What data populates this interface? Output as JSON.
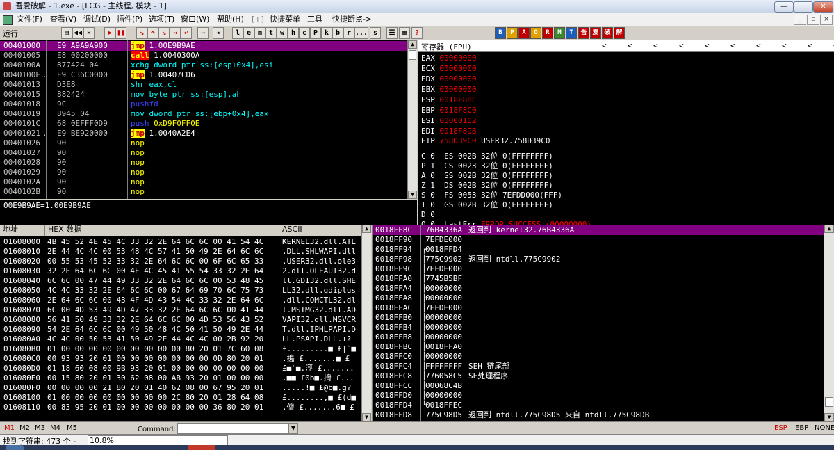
{
  "window": {
    "title": "吾爱破解 - 1.exe - [LCG - 主线程, 模块 - 1]",
    "btn_min": "—",
    "btn_max": "❐",
    "btn_close": "✕"
  },
  "menu": {
    "items": [
      "文件(F)",
      "查看(V)",
      "调试(D)",
      "插件(P)",
      "选项(T)",
      "窗口(W)",
      "帮助(H)",
      "[+]",
      "快捷菜单",
      "工具",
      "快捷断点->"
    ]
  },
  "toolbar": {
    "run_state": "运行",
    "letters": [
      "l",
      "e",
      "m",
      "t",
      "w",
      "h",
      "c",
      "P",
      "k",
      "b",
      "r",
      "...",
      "s"
    ],
    "right_icons": [
      "B",
      "P",
      "A",
      "O",
      "R",
      "M",
      "T",
      "吾",
      "爱",
      "破",
      "解"
    ],
    "icon_colors": [
      "#1d5fb8",
      "#e0a000",
      "#c00000",
      "#e0a000",
      "#c00000",
      "#3c8a2e",
      "#1d5fb8",
      "#c00000",
      "#c00000",
      "#c00000",
      "#c00000"
    ]
  },
  "disasm": {
    "rows": [
      {
        "addr": "00401000",
        "mark": "  ",
        "hex": "E9 A9A9A900",
        "asm": [
          {
            "t": "jmp",
            "c": "jmp"
          },
          {
            "t": " 1.00E9B9AE",
            "c": "white"
          }
        ]
      },
      {
        "addr": "00401005",
        "mark": "  ",
        "hex": "E8 00200000",
        "asm": [
          {
            "t": "call",
            "c": "call"
          },
          {
            "t": " 1.0040300A",
            "c": "white"
          }
        ]
      },
      {
        "addr": "0040100A",
        "mark": "  ",
        "hex": "877424 04",
        "asm": [
          {
            "t": "xchg dword ptr ss:[esp+0x4],esi",
            "c": "kw"
          }
        ]
      },
      {
        "addr": "0040100E",
        "mark": ". ",
        "hex": "E9 C36C0000",
        "asm": [
          {
            "t": "jmp",
            "c": "jmp"
          },
          {
            "t": " 1.00407CD6",
            "c": "white"
          }
        ]
      },
      {
        "addr": "00401013",
        "mark": "  ",
        "hex": "D3E8",
        "asm": [
          {
            "t": "shr eax,cl",
            "c": "kw"
          }
        ]
      },
      {
        "addr": "00401015",
        "mark": "  ",
        "hex": "882424",
        "asm": [
          {
            "t": "mov byte ptr ss:[esp],ah",
            "c": "kw"
          }
        ]
      },
      {
        "addr": "00401018",
        "mark": "  ",
        "hex": "9C",
        "asm": [
          {
            "t": "pushfd",
            "c": "push"
          }
        ]
      },
      {
        "addr": "00401019",
        "mark": "  ",
        "hex": "8945 04",
        "asm": [
          {
            "t": "mov dword ptr ss:[ebp+0x4],eax",
            "c": "kw"
          }
        ]
      },
      {
        "addr": "0040101C",
        "mark": "  ",
        "hex": "68 0EFFF0D9",
        "asm": [
          {
            "t": "push",
            "c": "push"
          },
          {
            "t": " 0xD9F0FF0E",
            "c": "imm"
          }
        ]
      },
      {
        "addr": "00401021",
        "mark": ". ",
        "hex": "E9 BE920000",
        "asm": [
          {
            "t": "jmp",
            "c": "jmp"
          },
          {
            "t": " 1.0040A2E4",
            "c": "white"
          }
        ]
      },
      {
        "addr": "00401026",
        "mark": "  ",
        "hex": "90",
        "asm": [
          {
            "t": "nop",
            "c": "nop"
          }
        ]
      },
      {
        "addr": "00401027",
        "mark": "  ",
        "hex": "90",
        "asm": [
          {
            "t": "nop",
            "c": "nop"
          }
        ]
      },
      {
        "addr": "00401028",
        "mark": "  ",
        "hex": "90",
        "asm": [
          {
            "t": "nop",
            "c": "nop"
          }
        ]
      },
      {
        "addr": "00401029",
        "mark": "  ",
        "hex": "90",
        "asm": [
          {
            "t": "nop",
            "c": "nop"
          }
        ]
      },
      {
        "addr": "0040102A",
        "mark": "  ",
        "hex": "90",
        "asm": [
          {
            "t": "nop",
            "c": "nop"
          }
        ]
      },
      {
        "addr": "0040102B",
        "mark": "  ",
        "hex": "90",
        "asm": [
          {
            "t": "nop",
            "c": "nop"
          }
        ]
      }
    ],
    "info": "00E9B9AE=1.00E9B9AE"
  },
  "registers": {
    "header": "寄存器 (FPU)",
    "nav": [
      "<",
      "<",
      "<",
      "<",
      "<",
      "<",
      "<",
      "<",
      "<",
      "<"
    ],
    "gp": [
      {
        "name": "EAX",
        "val": "00000000"
      },
      {
        "name": "ECX",
        "val": "00000000"
      },
      {
        "name": "EDX",
        "val": "00000000"
      },
      {
        "name": "EBX",
        "val": "00000000"
      },
      {
        "name": "ESP",
        "val": "0018F88C"
      },
      {
        "name": "EBP",
        "val": "0018F8C0"
      },
      {
        "name": "ESI",
        "val": "00000102"
      },
      {
        "name": "EDI",
        "val": "0018F898"
      }
    ],
    "eip": {
      "name": "EIP",
      "val": "758D39C0",
      "sym": "USER32.758D39C0"
    },
    "flags": [
      "C 0  ES 002B 32位 0(FFFFFFFF)",
      "P 1  CS 0023 32位 0(FFFFFFFF)",
      "A 0  SS 002B 32位 0(FFFFFFFF)",
      "Z 1  DS 002B 32位 0(FFFFFFFF)",
      "S 0  FS 0053 32位 7EFDD000(FFF)",
      "T 0  GS 002B 32位 0(FFFFFFFF)",
      "D 0"
    ],
    "lasterr_label": "O 0  LastErr",
    "lasterr_val": "ERROR_SUCCESS (00000000)"
  },
  "dump": {
    "col_addr": "地址",
    "col_hex": "HEX 数据",
    "col_ascii": "ASCII",
    "rows": [
      {
        "a": "01608000",
        "h": "4B 45 52 4E 45 4C 33 32 2E 64 6C 6C 00 41 54 4C",
        "s": "KERNEL32.dll.ATL"
      },
      {
        "a": "01608010",
        "h": "2E 44 4C 4C 00 53 48 4C 57 41 50 49 2E 64 6C 6C",
        "s": ".DLL.SHLWAPI.dll"
      },
      {
        "a": "01608020",
        "h": "00 55 53 45 52 33 32 2E 64 6C 6C 00 6F 6C 65 33",
        "s": ".USER32.dll.ole3"
      },
      {
        "a": "01608030",
        "h": "32 2E 64 6C 6C 00 4F 4C 45 41 55 54 33 32 2E 64",
        "s": "2.dll.OLEAUT32.d"
      },
      {
        "a": "01608040",
        "h": "6C 6C 00 47 44 49 33 32 2E 64 6C 6C 00 53 48 45",
        "s": "ll.GDI32.dll.SHE"
      },
      {
        "a": "01608050",
        "h": "4C 4C 33 32 2E 64 6C 6C 00 67 64 69 70 6C 75 73",
        "s": "LL32.dll.gdiplus"
      },
      {
        "a": "01608060",
        "h": "2E 64 6C 6C 00 43 4F 4D 43 54 4C 33 32 2E 64 6C",
        "s": ".dll.COMCTL32.dl"
      },
      {
        "a": "01608070",
        "h": "6C 00 4D 53 49 4D 47 33 32 2E 64 6C 6C 00 41 44",
        "s": "l.MSIMG32.dll.AD"
      },
      {
        "a": "01608080",
        "h": "56 41 50 49 33 32 2E 64 6C 6C 00 4D 53 56 43 52",
        "s": "VAPI32.dll.MSVCR"
      },
      {
        "a": "01608090",
        "h": "54 2E 64 6C 6C 00 49 50 48 4C 50 41 50 49 2E 44",
        "s": "T.dll.IPHLPAPI.D"
      },
      {
        "a": "016080A0",
        "h": "4C 4C 00 50 53 41 50 49 2E 44 4C 4C 00 2B 92 20",
        "s": "LL.PSAPI.DLL.+? "
      },
      {
        "a": "016080B0",
        "h": "01 00 00 00 00 00 00 00 00 00 80 20 01 7C 60 08",
        "s": "£.........■ £|`■"
      },
      {
        "a": "016080C0",
        "h": "00 93 93 20 01 00 00 00 00 00 00 00 0D 80 20 01",
        "s": ".搗 £.......■ £"
      },
      {
        "a": "016080D0",
        "h": "01 18 60 08 00 9B 93 20 01 00 00 00 00 00 00 00",
        "s": "£■`■.涇 £......."
      },
      {
        "a": "016080E0",
        "h": "00 15 80 20 01 30 62 08 00 AB 93 20 01 00 00 00",
        "s": ".■■ £0b■.搚 £..."
      },
      {
        "a": "016080F0",
        "h": "00 00 00 00 21 80 20 01 40 62 08 00 67 95 20 01",
        "s": ".....!■ £@b■.g? "
      },
      {
        "a": "01608100",
        "h": "01 00 00 00 00 00 00 00 00 2C 80 20 01 28 64 08",
        "s": "£........,■ £(d■"
      },
      {
        "a": "01608110",
        "h": "00 83 95 20 01 00 00 00 00 00 00 00 36 80 20 01",
        "s": ".儃 £.......6■ £"
      }
    ]
  },
  "stack": {
    "rows": [
      {
        "a": "0018FF8C",
        "m": " ",
        "v": "76B4336A",
        "c": "返回到 kernel32.76B4336A",
        "sel": true
      },
      {
        "a": "0018FF90",
        "m": " ",
        "v": "7EFDE000",
        "c": "",
        "sel": false
      },
      {
        "a": "0018FF94",
        "m": "┌",
        "v": "0018FFD4",
        "c": "",
        "sel": false
      },
      {
        "a": "0018FF98",
        "m": "│",
        "v": "775C9902",
        "c": "返回到 ntdll.775C9902",
        "sel": false
      },
      {
        "a": "0018FF9C",
        "m": "│",
        "v": "7EFDE000",
        "c": "",
        "sel": false
      },
      {
        "a": "0018FFA0",
        "m": "│",
        "v": "7745B5BF",
        "c": "",
        "sel": false
      },
      {
        "a": "0018FFA4",
        "m": "│",
        "v": "00000000",
        "c": "",
        "sel": false
      },
      {
        "a": "0018FFA8",
        "m": "│",
        "v": "00000000",
        "c": "",
        "sel": false
      },
      {
        "a": "0018FFAC",
        "m": "│",
        "v": "7EFDE000",
        "c": "",
        "sel": false
      },
      {
        "a": "0018FFB0",
        "m": "│",
        "v": "00000000",
        "c": "",
        "sel": false
      },
      {
        "a": "0018FFB4",
        "m": "│",
        "v": "00000000",
        "c": "",
        "sel": false
      },
      {
        "a": "0018FFB8",
        "m": "│",
        "v": "00000000",
        "c": "",
        "sel": false
      },
      {
        "a": "0018FFBC",
        "m": "│",
        "v": "0018FFA0",
        "c": "",
        "sel": false
      },
      {
        "a": "0018FFC0",
        "m": "│",
        "v": "00000000",
        "c": "",
        "sel": false
      },
      {
        "a": "0018FFC4",
        "m": "│",
        "v": "FFFFFFFF",
        "c": "SEH 链尾部",
        "sel": false
      },
      {
        "a": "0018FFC8",
        "m": "│",
        "v": "776058C5",
        "c": "SE处理程序",
        "sel": false
      },
      {
        "a": "0018FFCC",
        "m": "│",
        "v": "00068C4B",
        "c": "",
        "sel": false
      },
      {
        "a": "0018FFD0",
        "m": "│",
        "v": "00000000",
        "c": "",
        "sel": false
      },
      {
        "a": "0018FFD4",
        "m": "└",
        "v": "0018FFEC",
        "c": "",
        "sel": false
      },
      {
        "a": "0018FFD8",
        "m": " ",
        "v": "775C98D5",
        "c": "返回到 ntdll.775C98D5 来自 ntdll.775C98DB",
        "sel": false
      }
    ]
  },
  "bottom": {
    "mtabs": [
      "M1",
      "M2",
      "M3",
      "M4",
      "M5"
    ],
    "command_label": "Command:",
    "command_value": "",
    "right": [
      "ESP",
      "EBP",
      "NONE"
    ]
  },
  "status": {
    "text": "找到字符串: 473 个 -",
    "percent": "10.8%"
  }
}
